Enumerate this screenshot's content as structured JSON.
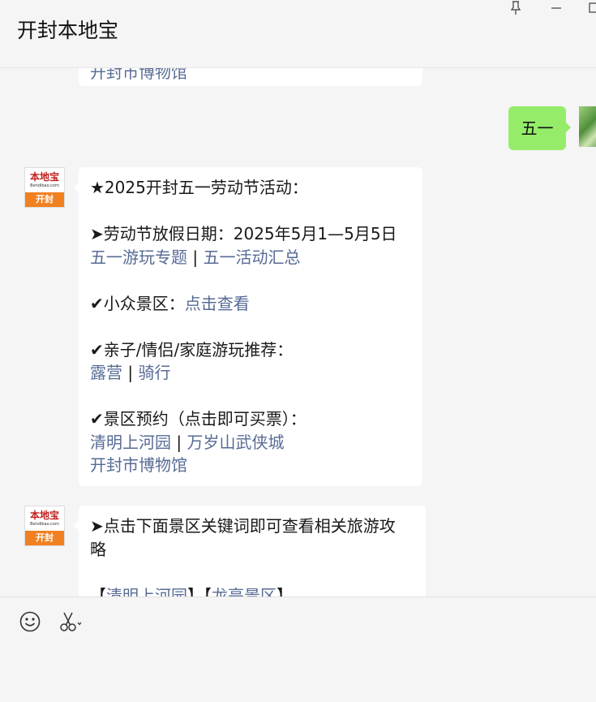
{
  "window": {
    "title": "开封本地宝",
    "pin_icon": "pin-icon",
    "minimize_icon": "minimize-icon",
    "maximize_icon": "maximize-icon"
  },
  "messages": {
    "prev_fragment": "开封市博物馆",
    "me_text": "五一",
    "avatar": {
      "brand": "本地宝",
      "url": "Bendibao.com",
      "city": "开封"
    },
    "msg1": {
      "heading": "★2025开封五一劳动节活动：",
      "holiday": "➤劳动节放假日期：2025年5月1—5月5日",
      "link_topic": "五一游玩专题",
      "link_events": "五一活动汇总",
      "niche_label": "✔小众景区：",
      "niche_link": "点击查看",
      "family_label": "✔亲子/情侣/家庭游玩推荐：",
      "link_camping": "露营",
      "link_cycling": "骑行",
      "booking_label": "✔景区预约（点击即可买票）：",
      "link_qingming": "清明上河园",
      "link_wansui": "万岁山武侠城",
      "link_museum": "开封市博物馆",
      "separator": "|"
    },
    "msg2": {
      "line1": "➤点击下面景区关键词即可查看相关旅游攻",
      "line2": "略",
      "bracket_open": "【",
      "bracket_mid": "】【",
      "bracket_close": "】",
      "link_qingming": "清明上河园",
      "link_longting": "龙亭景区"
    }
  },
  "toolbar": {
    "emoji_icon": "emoji-icon",
    "screenshot_icon": "scissors-icon"
  }
}
